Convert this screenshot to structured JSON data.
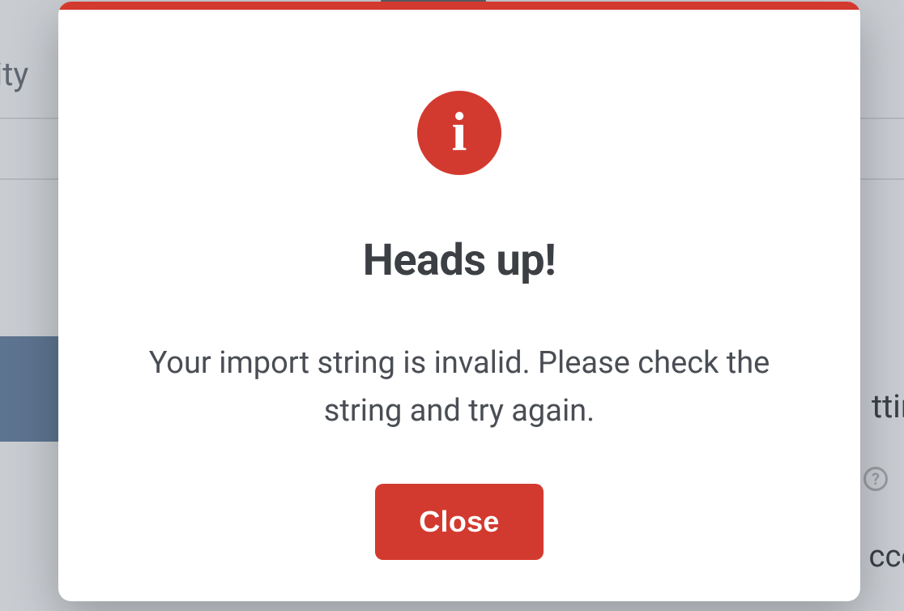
{
  "background": {
    "sidebar_text_fragment": "rity",
    "right_label_fragment_1": "ttin",
    "right_label_fragment_2": "cco",
    "help_icon_label": "?"
  },
  "modal": {
    "icon_name": "info-icon",
    "title": "Heads up!",
    "body": "Your import string is invalid. Please check the string and try again.",
    "close_label": "Close"
  },
  "colors": {
    "accent": "#d33a2f",
    "text_dark": "#3c3f44",
    "text_body": "#4a4e54",
    "bg_gray": "#c9cdd2"
  }
}
